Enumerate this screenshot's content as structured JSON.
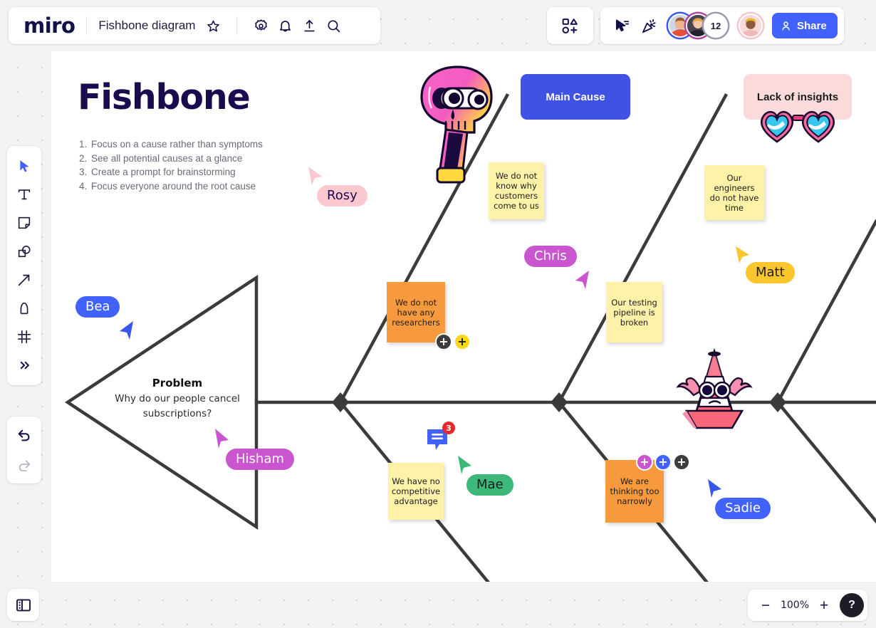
{
  "app": {
    "brand": "miro",
    "board_title": "Fishbone diagram"
  },
  "topbar": {
    "icons": [
      {
        "name": "star-icon",
        "label": "Favorite"
      },
      {
        "name": "gear-icon",
        "label": "Settings"
      },
      {
        "name": "bell-icon",
        "label": "Notifications"
      },
      {
        "name": "upload-icon",
        "label": "Upload"
      },
      {
        "name": "search-icon",
        "label": "Search"
      }
    ],
    "apps_icon": "shapes-plus-icon",
    "pointer_icon": "cursor-select-icon",
    "celebrate_icon": "party-popper-icon",
    "collab_overflow_count": "12",
    "share_label": "Share"
  },
  "left_toolbar": {
    "tools": [
      {
        "name": "cursor-tool",
        "icon": "cursor-icon",
        "selected": true
      },
      {
        "name": "text-tool",
        "icon": "text-t-icon",
        "selected": false
      },
      {
        "name": "sticky-note-tool",
        "icon": "sticky-note-icon",
        "selected": false
      },
      {
        "name": "shapes-tool",
        "icon": "shapes-icon",
        "selected": false
      },
      {
        "name": "connector-tool",
        "icon": "arrow-icon",
        "selected": false
      },
      {
        "name": "pen-tool",
        "icon": "pen-icon",
        "selected": false
      },
      {
        "name": "frame-tool",
        "icon": "frame-icon",
        "selected": false
      },
      {
        "name": "more-tools",
        "icon": "chevron-double-right-icon",
        "selected": false
      }
    ],
    "undo_icon": "undo-icon",
    "redo_icon": "redo-icon",
    "panel_toggle_icon": "sidebar-panel-icon"
  },
  "zoom_controls": {
    "minus_label": "−",
    "level": "100%",
    "plus_label": "+",
    "help_label": "?"
  },
  "board": {
    "heading": "Fishbone",
    "intro_items": [
      "Focus on a cause rather than symptoms",
      "See all potential causes at a glance",
      "Create a prompt for brainstorming",
      "Focus everyone around the root cause"
    ],
    "problem": {
      "title": "Problem",
      "question": "Why do our people cancel subscriptions?"
    },
    "cause_boxes": [
      {
        "name": "main-cause-box",
        "label": "Main Cause",
        "color": "#3f52e3"
      },
      {
        "name": "lack-of-insights-box",
        "label": "Lack of insights",
        "color": "#fadada"
      }
    ],
    "sticky_notes": [
      {
        "name": "sticky-customers",
        "text": "We do not know why customers come to us",
        "color": "#fdf2a8"
      },
      {
        "name": "sticky-engineers",
        "text": "Our engineers do not have time",
        "color": "#fdf2a8"
      },
      {
        "name": "sticky-researchers",
        "text": "We do not have any researchers",
        "color": "#f79a3e"
      },
      {
        "name": "sticky-testing",
        "text": "Our testing pipeline is broken",
        "color": "#fdf2a8"
      },
      {
        "name": "sticky-competitive",
        "text": "We have no competitive advantage",
        "color": "#fdf2a8"
      },
      {
        "name": "sticky-narrow",
        "text": "We are thinking too narrowly",
        "color": "#f79a3e"
      }
    ],
    "reactions": [
      {
        "name": "reaction-chip-dark-researchers",
        "glyph": "+",
        "color": "#3c3c3c"
      },
      {
        "name": "reaction-chip-yellow-researchers",
        "glyph": "+",
        "color": "#fbd81f"
      },
      {
        "name": "reaction-chip-pink-narrow",
        "glyph": "+",
        "color": "#c955cf"
      },
      {
        "name": "reaction-chip-blue-narrow",
        "glyph": "+",
        "color": "#4262ff"
      },
      {
        "name": "reaction-chip-dark-narrow",
        "glyph": "+",
        "color": "#3c3c3c"
      }
    ],
    "comment": {
      "name": "comment-pin",
      "count": "3"
    },
    "cursors": [
      {
        "name": "cursor-rosy",
        "label": "Rosy",
        "bg": "#fac8ce",
        "fg": "#1a0a4e"
      },
      {
        "name": "cursor-chris",
        "label": "Chris",
        "bg": "#c955cf",
        "fg": "#ffffff"
      },
      {
        "name": "cursor-matt",
        "label": "Matt",
        "bg": "#fbc52d",
        "fg": "#1d1d1d"
      },
      {
        "name": "cursor-bea",
        "label": "Bea",
        "bg": "#4262ff",
        "fg": "#ffffff"
      },
      {
        "name": "cursor-hisham",
        "label": "Hisham",
        "bg": "#c955cf",
        "fg": "#ffffff"
      },
      {
        "name": "cursor-mae",
        "label": "Mae",
        "bg": "#3cb878",
        "fg": "#1d1d1d"
      },
      {
        "name": "cursor-sadie",
        "label": "Sadie",
        "bg": "#4262ff",
        "fg": "#ffffff"
      }
    ],
    "stickers": [
      {
        "name": "skull-telescope-sticker"
      },
      {
        "name": "heart-sunglasses-sticker"
      },
      {
        "name": "traffic-cone-sticker"
      }
    ]
  }
}
